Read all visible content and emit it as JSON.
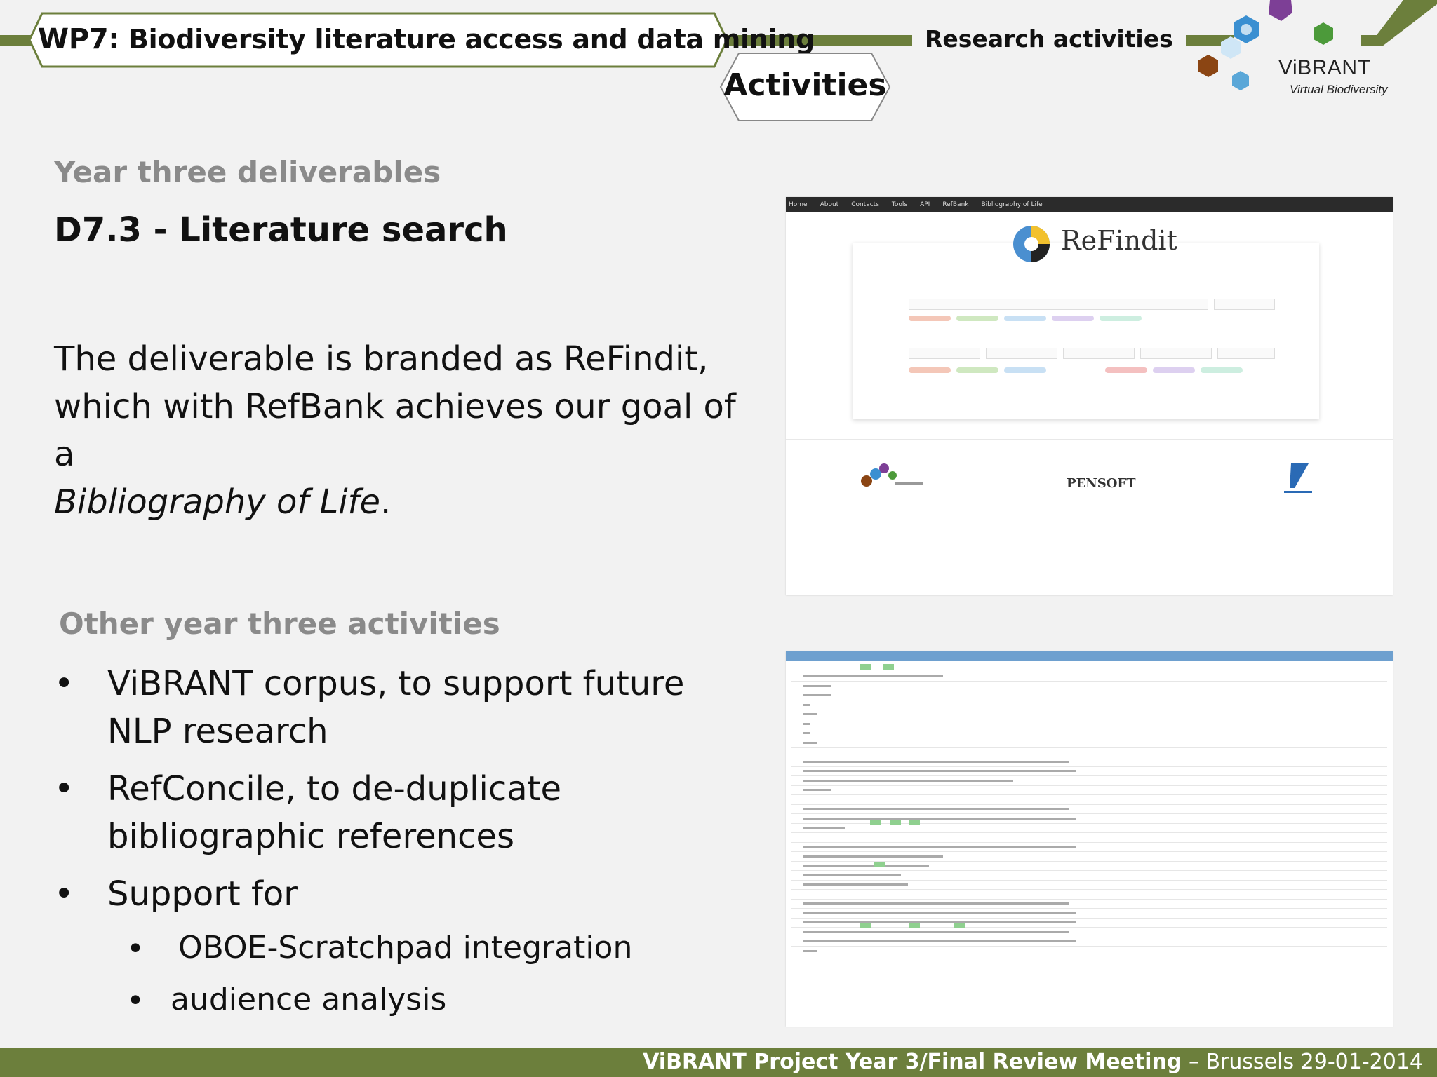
{
  "header": {
    "wp_label": "WP7:",
    "title": "Biodiversity literature access and data mining",
    "section_tab": "Activities",
    "research_label": "Research activities"
  },
  "logo": {
    "name": "ViBRANT",
    "tagline": "Virtual Biodiversity"
  },
  "content": {
    "subhead1": "Year three deliverables",
    "deliverable_title": "D7.3 - Literature search",
    "paragraph_line1": "The deliverable is branded as ReFindit,",
    "paragraph_line2": "which with RefBank achieves our goal of a",
    "paragraph_italic": "Bibliography of Life",
    "paragraph_end": ".",
    "subhead2": "Other year three activities",
    "bullets": [
      {
        "line1": "ViBRANT corpus, to support future",
        "line2": "NLP research"
      },
      {
        "line1": "RefConcile, to de-duplicate",
        "line2": "bibliographic references"
      },
      {
        "line1": "Support for"
      }
    ],
    "sub_bullets": [
      "OBOE-Scratchpad integration",
      "audience analysis"
    ],
    "bullet_symbol": "•"
  },
  "screenshot1": {
    "brand": "ReFindit",
    "nav": [
      "Home",
      "About",
      "Contacts",
      "Tools",
      "API",
      "RefBank",
      "Bibliography of Life"
    ],
    "partner": "PENSOFT"
  },
  "footer": {
    "bold": "ViBRANT Project Year 3/Final Review Meeting",
    "rest": " – Brussels 29-01-2014"
  },
  "colors": {
    "olive": "#6c7f3c",
    "grey_heading": "#8a8a8a",
    "background": "#f2f2f2"
  }
}
